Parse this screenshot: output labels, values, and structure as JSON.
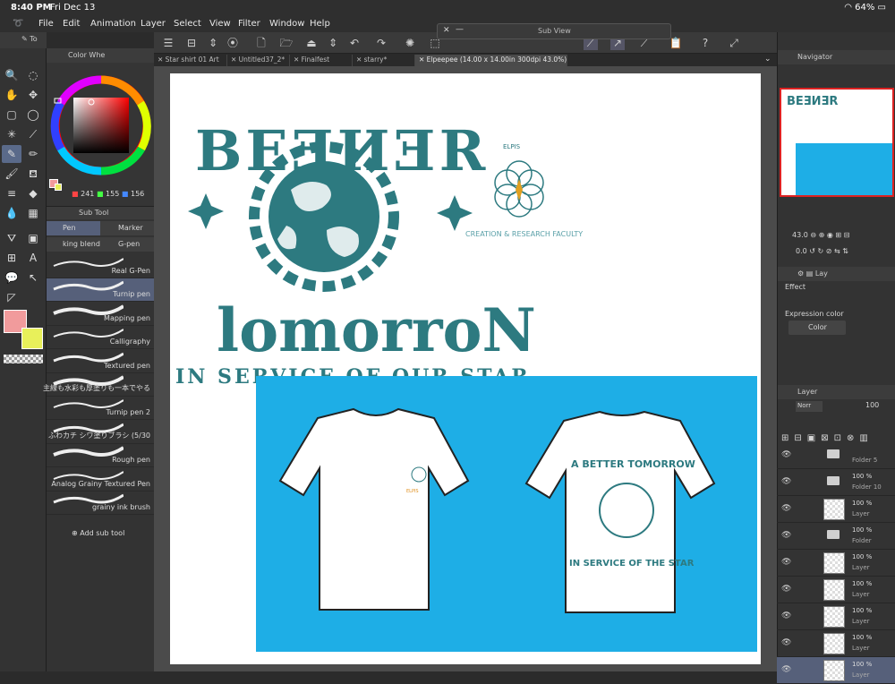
{
  "status_bar": {
    "time": "8:40 PM",
    "date": "Fri Dec 13",
    "battery": "64%"
  },
  "menu": [
    "File",
    "Edit",
    "Animation",
    "Layer",
    "Select",
    "View",
    "Filter",
    "Window",
    "Help"
  ],
  "sub_view": {
    "title": "Sub View"
  },
  "color_panel": {
    "title": "Color Whe",
    "r": "241",
    "g": "155",
    "b": "156",
    "main_color": "#f19b9c",
    "sub_color": "#e8f05a"
  },
  "subtool": {
    "title": "Sub Tool",
    "tabs": [
      "Pen",
      "Marker",
      "king blend",
      "G-pen"
    ],
    "brushes": [
      "Real G-Pen",
      "Turnip pen",
      "Mapping pen",
      "Calligraphy",
      "Textured pen",
      "主線も水彩も厚塗りも一本でやる",
      "Turnip pen 2",
      "ふわカチ シワ塗りブラシ (5/30",
      "Rough pen",
      "Analog Grainy Textured Pen",
      "grainy ink brush"
    ],
    "add_label": "Add sub tool"
  },
  "tabs": [
    {
      "label": "Star shirt 01 Art"
    },
    {
      "label": "Untitled37_2*"
    },
    {
      "label": "Finalfest"
    },
    {
      "label": "starry*"
    },
    {
      "label": "Elpeepee (14.00 x 14.00in 300dpi 43.0%)"
    }
  ],
  "canvas": {
    "title_text": "BEƎИƎR",
    "tomorrow_text": "lomorroN",
    "service_text": "IN SERVICE OF OUR STAR",
    "logo_caption": "CREATION & RESEARCH FACULTY",
    "logo_name": "ELPIS",
    "tshirt_back_top": "A BETTER TOMORROW",
    "tshirt_back_bottom": "IN SERVICE OF THE STAR",
    "accent": "#2d7a80",
    "panel_blue": "#1eaee6"
  },
  "navigator": {
    "title": "Navigator",
    "zoom": "43.0",
    "rotate": "0.0"
  },
  "effect": {
    "title": "Effect",
    "expression_color_label": "Expression color",
    "expression_value": "Color"
  },
  "layer_panel": {
    "title": "Layer",
    "blend": "Norr",
    "opacity": "100",
    "rows": [
      {
        "pct": "",
        "name": "Folder 5",
        "type": "folder"
      },
      {
        "pct": "100 %",
        "name": "Folder 10",
        "type": "folder"
      },
      {
        "pct": "100 %",
        "name": "Layer",
        "type": "layer"
      },
      {
        "pct": "100 %",
        "name": "Folder",
        "type": "folder"
      },
      {
        "pct": "100 %",
        "name": "Layer",
        "type": "layer"
      },
      {
        "pct": "100 %",
        "name": "Layer",
        "type": "layer"
      },
      {
        "pct": "100 %",
        "name": "Layer",
        "type": "layer"
      },
      {
        "pct": "100 %",
        "name": "Layer",
        "type": "layer"
      },
      {
        "pct": "100 %",
        "name": "Layer",
        "type": "layer"
      }
    ]
  }
}
